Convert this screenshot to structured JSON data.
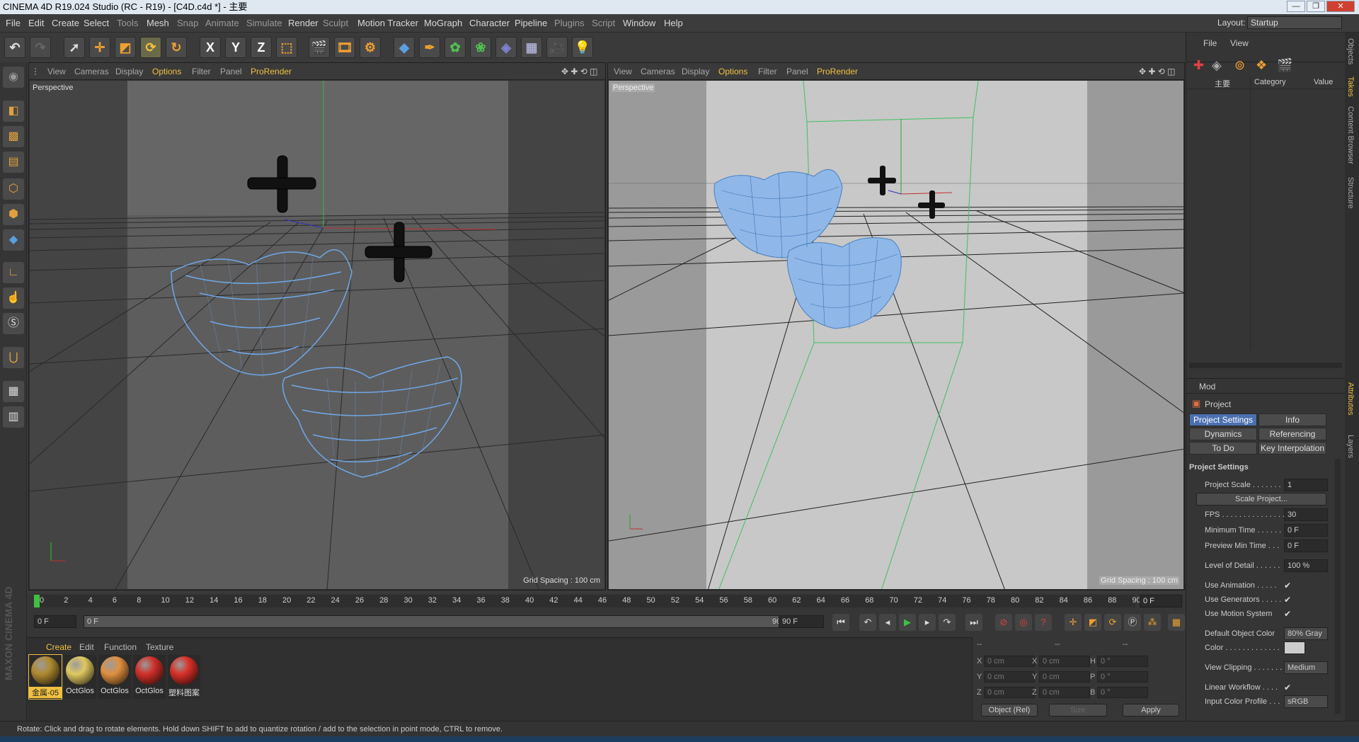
{
  "app": {
    "title": "CINEMA 4D R19.024 Studio (RC - R19) - [C4D.c4d *] - 主要"
  },
  "window_controls": {
    "minimize": "—",
    "maximize": "❐",
    "close": "✕"
  },
  "menubar": {
    "items": [
      "File",
      "Edit",
      "Create",
      "Select",
      "Tools",
      "Mesh",
      "Snap",
      "Animate",
      "Simulate",
      "Render",
      "Sculpt",
      "Motion Tracker",
      "MoGraph",
      "Character",
      "Pipeline",
      "Plugins",
      "Script",
      "Window",
      "Help"
    ],
    "layout_label": "Layout:",
    "layout_value": "Startup"
  },
  "toolbar": {
    "axis_x": "X",
    "axis_y": "Y",
    "axis_z": "Z"
  },
  "viewport_left": {
    "menu": [
      "View",
      "Cameras",
      "Display",
      "Options",
      "Filter",
      "Panel",
      "ProRender"
    ],
    "highlighted": [
      "Options",
      "ProRender"
    ],
    "label": "Perspective",
    "grid_spacing": "Grid Spacing : 100 cm"
  },
  "viewport_right": {
    "menu": [
      "View",
      "Cameras",
      "Display",
      "Options",
      "Filter",
      "Panel",
      "ProRender"
    ],
    "highlighted": [
      "Options",
      "ProRender"
    ],
    "label": "Perspective",
    "grid_spacing": "Grid Spacing : 100 cm"
  },
  "timeline": {
    "ticks": [
      "0",
      "2",
      "4",
      "6",
      "8",
      "10",
      "12",
      "14",
      "16",
      "18",
      "20",
      "22",
      "24",
      "26",
      "28",
      "30",
      "32",
      "34",
      "36",
      "38",
      "40",
      "42",
      "44",
      "46",
      "48",
      "50",
      "52",
      "54",
      "56",
      "58",
      "60",
      "62",
      "64",
      "66",
      "68",
      "70",
      "72",
      "74",
      "76",
      "78",
      "80",
      "82",
      "84",
      "86",
      "88",
      "90"
    ],
    "current_frame": "0 F",
    "start_field": "0 F",
    "range_start": "0 F",
    "range_end": "90 F",
    "end_field": "90 F"
  },
  "materials": {
    "tabs": [
      "Create",
      "Edit",
      "Function",
      "Texture"
    ],
    "items": [
      {
        "label": "金属-05",
        "color": "#b08a30",
        "selected": true
      },
      {
        "label": "OctGlos",
        "color": "#e0c860",
        "selected": false
      },
      {
        "label": "OctGlos",
        "color": "#e09040",
        "selected": false
      },
      {
        "label": "OctGlos",
        "color": "#d03028",
        "selected": false
      },
      {
        "label": "塑料图案",
        "color": "#d83028",
        "selected": false
      }
    ]
  },
  "coordinates": {
    "header": [
      "--",
      "--",
      "--"
    ],
    "rows": [
      {
        "a": "X",
        "av": "0 cm",
        "b": "X",
        "bv": "0 cm",
        "c": "H",
        "cv": "0 °"
      },
      {
        "a": "Y",
        "av": "0 cm",
        "b": "Y",
        "bv": "0 cm",
        "c": "P",
        "cv": "0 °"
      },
      {
        "a": "Z",
        "av": "0 cm",
        "b": "Z",
        "bv": "0 cm",
        "c": "B",
        "cv": "0 °"
      }
    ],
    "mode_select": "Object (Rel)",
    "size_select": "Size",
    "apply": "Apply"
  },
  "status": {
    "text": "Rotate: Click and drag to rotate elements. Hold down SHIFT to add to quantize rotation / add to the selection in point mode, CTRL to remove."
  },
  "object_manager": {
    "menu": [
      "File",
      "View"
    ],
    "columns": {
      "name": "主要",
      "category": "Category",
      "value": "Value"
    }
  },
  "attributes": {
    "mode": "Mod",
    "object": "Project",
    "tabs": [
      "Project Settings",
      "Info",
      "Dynamics",
      "Referencing",
      "To Do",
      "Key Interpolation"
    ],
    "section": "Project Settings",
    "scale_button": "Scale Project...",
    "props": [
      {
        "label": "Project Scale . . . . . . .",
        "value": "1"
      },
      {
        "label": "FPS . . . . . . . . . . . . . . .",
        "value": "30"
      },
      {
        "label": "Minimum Time . . . . . .",
        "value": "0 F"
      },
      {
        "label": "Preview Min Time . . .",
        "value": "0 F"
      },
      {
        "label": "Level of Detail . . . . . .",
        "value": "100 %"
      },
      {
        "label": "Use Animation . . . . .",
        "check": "✔"
      },
      {
        "label": "Use Generators . . . . .",
        "check": "✔"
      },
      {
        "label": "Use Motion System",
        "check": "✔"
      },
      {
        "label": "Default Object Color",
        "value": "80% Gray"
      },
      {
        "label": "Color . . . . . . . . . . . . .",
        "value": ""
      },
      {
        "label": "View Clipping . . . . . . .",
        "value": "Medium"
      },
      {
        "label": "Linear Workflow . . . .",
        "check": "✔"
      },
      {
        "label": "Input Color Profile . . .",
        "value": "sRGB"
      }
    ]
  },
  "side_tabs": [
    "Objects",
    "Takes",
    "Content Browser",
    "Structure",
    "Attributes",
    "Layers"
  ],
  "watermark": "MAXON CINEMA 4D"
}
